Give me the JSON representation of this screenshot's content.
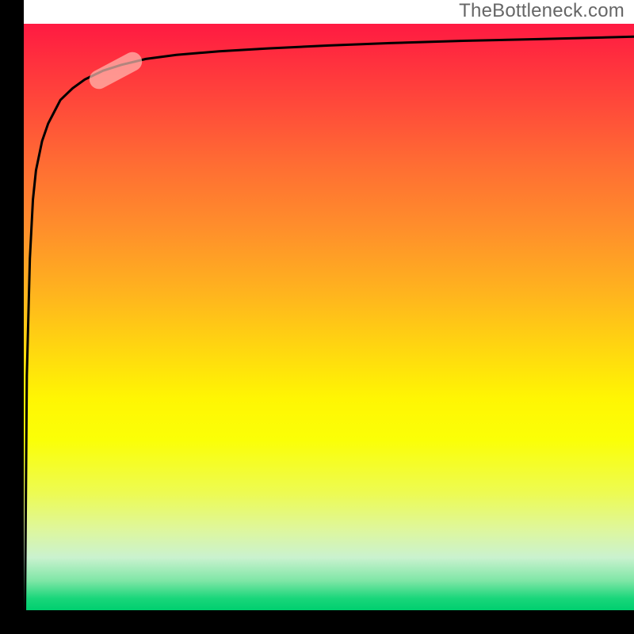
{
  "watermark": {
    "text": "TheBottleneck.com"
  },
  "colors": {
    "axis": "#000000",
    "curve": "#000000",
    "marker": "rgba(255,190,180,0.70)",
    "watermark_text": "#666666"
  },
  "chart_data": {
    "type": "line",
    "title": "",
    "xlabel": "",
    "ylabel": "",
    "xlim": [
      0,
      100
    ],
    "ylim": [
      0,
      100
    ],
    "grid": false,
    "legend": false,
    "series": [
      {
        "name": "curve",
        "x": [
          0.2,
          0.5,
          1,
          1.5,
          2,
          3,
          4,
          5,
          6,
          8,
          10,
          13,
          16,
          20,
          25,
          32,
          40,
          50,
          60,
          72,
          85,
          100
        ],
        "y": [
          0,
          40,
          60,
          70,
          75,
          80,
          83,
          85,
          87,
          89,
          90.5,
          92,
          93,
          94,
          94.7,
          95.3,
          95.8,
          96.3,
          96.7,
          97.1,
          97.4,
          97.8
        ]
      }
    ],
    "marker": {
      "series": "curve",
      "x_center": 15,
      "y_center": 92,
      "angle_deg": -28
    },
    "background_gradient": {
      "direction": "top_to_bottom",
      "stops": [
        {
          "t": 0.0,
          "color": "#ff1a42"
        },
        {
          "t": 0.5,
          "color": "#ffd90f"
        },
        {
          "t": 0.75,
          "color": "#fbff07"
        },
        {
          "t": 1.0,
          "color": "#00cf6f"
        }
      ]
    }
  }
}
